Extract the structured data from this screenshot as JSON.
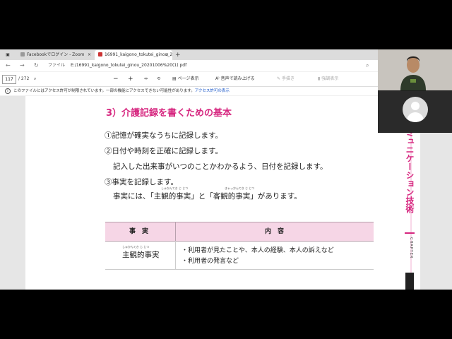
{
  "browser": {
    "tabs": [
      {
        "label": "Facebookでログイン - Zoom",
        "close": "×"
      },
      {
        "label": "16991_kaigono_tokutei_ginou_2",
        "close": "×"
      }
    ],
    "new_tab": "+",
    "address": {
      "label": "ファイル",
      "url": "E:/16991_kaigono_tokutei_ginou_20201006%20(1).pdf"
    }
  },
  "pdf_toolbar": {
    "page_number": "117",
    "page_count": "/ 272",
    "zoom_out": "−",
    "zoom_in": "+",
    "page_view": "ページ表示",
    "read_aloud": "音声で読み上げる",
    "draw": "手描き",
    "highlight": "強調表示"
  },
  "notice": {
    "text": "このファイルにはアクセス許可が制限されています。一部の機能にアクセスできない可能性があります。",
    "link": "アクセス許可の表示"
  },
  "document": {
    "heading": "3）介護記録を書くための基本",
    "lines": [
      "①記憶が確実なうちに記録します。",
      "②日付や時刻を正確に記録します。",
      "記入した出来事がいつのことかわかるよう、日付を記録します。",
      "③事実を記録します。",
      "事実には、「主観的事実」と「客観的事実」があります。"
    ],
    "ruby": [
      "しゅかんてき じ じつ",
      "きゃっかんてき じ じつ",
      "しゅかんてき じ じつ"
    ],
    "table": {
      "headers": [
        "事　実",
        "内　容"
      ],
      "rows": [
        {
          "key": "主観的事実",
          "items": [
            "・利用者が見たことや、本人の経験、本人の訴えなど",
            "・利用者の発言など"
          ]
        }
      ]
    },
    "side_title": "ミュニケーション技術",
    "chapter_label": "CHAPTER"
  },
  "colors": {
    "accent": "#d6267f",
    "table_header": "#f6d6e6"
  }
}
